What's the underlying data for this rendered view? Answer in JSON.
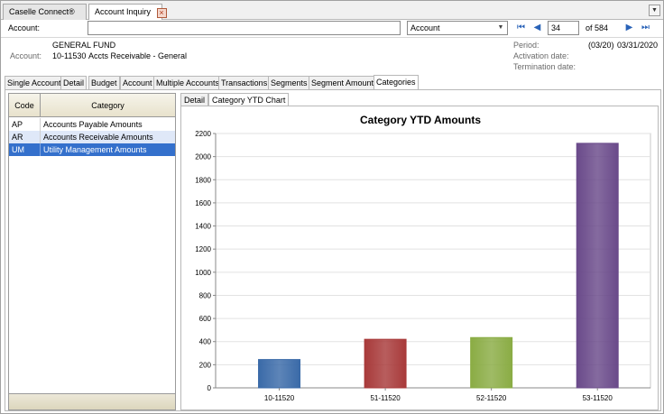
{
  "doc_tabs": [
    {
      "label": "Caselle Connect®"
    },
    {
      "label": "Account Inquiry"
    }
  ],
  "toolbar": {
    "account_label": "Account:",
    "account_value": "",
    "lookup_type": "Account",
    "record_number": "34",
    "record_total": "of 584"
  },
  "info": {
    "fund_name": "GENERAL FUND",
    "account_label": "Account:",
    "account_number": "10-11530",
    "account_desc": "Accts Receivable - General",
    "period_label": "Period:",
    "period_code": "(03/20)",
    "period_date": "03/31/2020",
    "activation_label": "Activation date:",
    "termination_label": "Termination date:"
  },
  "main_tabs": [
    "Single Account",
    "Detail",
    "Budget",
    "Account",
    "Multiple Accounts",
    "Transactions",
    "Segments",
    "Segment Amounts",
    "Categories"
  ],
  "grid": {
    "col_code": "Code",
    "col_category": "Category",
    "rows": [
      {
        "code": "AP",
        "category": "Accounts Payable Amounts"
      },
      {
        "code": "AR",
        "category": "Accounts Receivable Amounts"
      },
      {
        "code": "UM",
        "category": "Utility Management Amounts"
      }
    ]
  },
  "sub_tabs": [
    "Detail",
    "Category YTD Chart"
  ],
  "chart_data": {
    "type": "bar",
    "title": "Category YTD Amounts",
    "categories": [
      "10-11520",
      "51-11520",
      "52-11520",
      "53-11520"
    ],
    "values": [
      245,
      420,
      435,
      2115
    ],
    "colors": [
      "#3a6aa8",
      "#a83a3a",
      "#8aac44",
      "#6a4a8a"
    ],
    "ylim": [
      0,
      2200
    ],
    "yticks": [
      0,
      200,
      400,
      600,
      800,
      1000,
      1200,
      1400,
      1600,
      1800,
      2000,
      2200
    ],
    "grid": true,
    "legend": "none"
  }
}
